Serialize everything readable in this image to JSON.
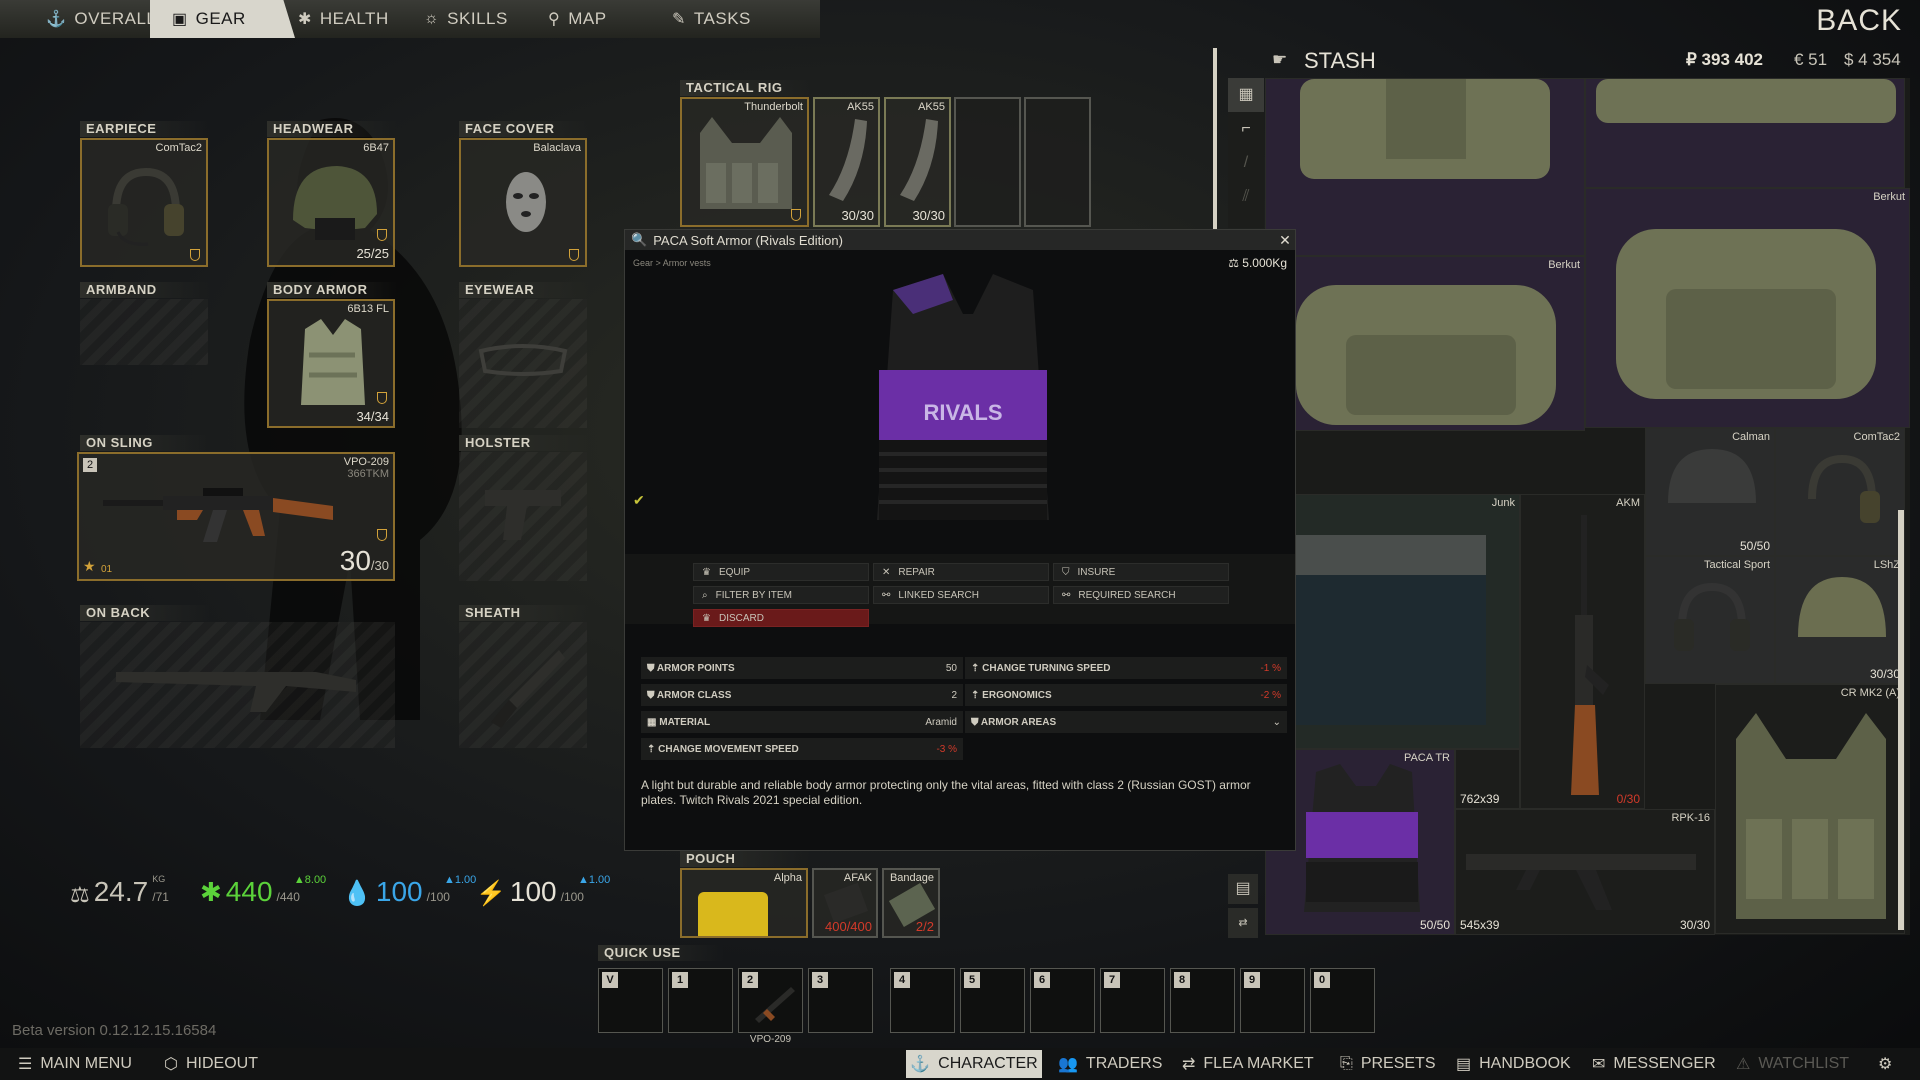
{
  "nav": {
    "tabs": [
      {
        "label": "OVERALL",
        "icon": "anchor-icon"
      },
      {
        "label": "GEAR",
        "icon": "vest-icon"
      },
      {
        "label": "HEALTH",
        "icon": "health-icon"
      },
      {
        "label": "SKILLS",
        "icon": "skills-icon"
      },
      {
        "label": "MAP",
        "icon": "map-pin-icon"
      },
      {
        "label": "TASKS",
        "icon": "tasks-icon"
      }
    ],
    "back_label": "BACK"
  },
  "slots": {
    "earpiece": {
      "label": "EARPIECE",
      "item": "ComTac2"
    },
    "headwear": {
      "label": "HEADWEAR",
      "item": "6B47",
      "durability": "25/25"
    },
    "face_cover": {
      "label": "FACE COVER",
      "item": "Balaclava"
    },
    "armband": {
      "label": "ARMBAND"
    },
    "body_armor": {
      "label": "BODY ARMOR",
      "item": "6B13 FL",
      "durability": "34/34"
    },
    "eyewear": {
      "label": "EYEWEAR"
    },
    "on_sling": {
      "label": "ON SLING",
      "item": "VPO-209",
      "sub": "366TKM",
      "ammo": "30",
      "ammo_max": "/30",
      "slot_key": "2",
      "rank": "01"
    },
    "holster": {
      "label": "HOLSTER"
    },
    "on_back": {
      "label": "ON BACK"
    },
    "sheath": {
      "label": "SHEATH"
    },
    "tactical_rig": {
      "label": "TACTICAL RIG",
      "item": "Thunderbolt",
      "mags": [
        {
          "name": "AK55",
          "count": "30/30"
        },
        {
          "name": "AK55",
          "count": "30/30"
        }
      ]
    },
    "pouch": {
      "label": "POUCH",
      "item": "Alpha",
      "items": [
        {
          "name": "AFAK",
          "count": "400/400"
        },
        {
          "name": "Bandage",
          "count": "2/2"
        }
      ]
    }
  },
  "stats": {
    "weight": {
      "value": "24.7",
      "unit": "KG",
      "max": "/71"
    },
    "health": {
      "value": "440",
      "max": "/440",
      "rate": "8.00"
    },
    "hydration": {
      "value": "100",
      "max": "/100",
      "rate": "1.00"
    },
    "energy": {
      "value": "100",
      "max": "/100",
      "rate": "1.00"
    }
  },
  "beta_version": "Beta version 0.12.12.15.16584",
  "modal": {
    "title": "PACA Soft Armor (Rivals Edition)",
    "breadcrumb": "Gear > Armor vests",
    "weight": "5.000Kg",
    "actions": [
      {
        "label": "EQUIP",
        "icon": "equip-icon"
      },
      {
        "label": "REPAIR",
        "icon": "repair-icon"
      },
      {
        "label": "INSURE",
        "icon": "insure-icon"
      },
      {
        "label": "FILTER BY ITEM",
        "icon": "filter-icon"
      },
      {
        "label": "LINKED SEARCH",
        "icon": "linked-icon"
      },
      {
        "label": "REQUIRED SEARCH",
        "icon": "required-icon"
      },
      {
        "label": "DISCARD",
        "icon": "discard-icon"
      }
    ],
    "props_left": [
      {
        "label": "ARMOR POINTS",
        "value": "50"
      },
      {
        "label": "ARMOR CLASS",
        "value": "2"
      },
      {
        "label": "MATERIAL",
        "value": "Aramid"
      },
      {
        "label": "CHANGE MOVEMENT SPEED",
        "value": "-3 %"
      }
    ],
    "props_right": [
      {
        "label": "CHANGE TURNING SPEED",
        "value": "-1 %"
      },
      {
        "label": "ERGONOMICS",
        "value": "-2 %"
      },
      {
        "label": "ARMOR AREAS",
        "value": ""
      }
    ],
    "description": "A light but durable and reliable body armor protecting only the vital areas, fitted with class 2 (Russian GOST) armor plates. Twitch Rivals 2021 special edition.",
    "vest_logo": "RIVALS"
  },
  "stash": {
    "title": "STASH",
    "rub": "₽ 393 402",
    "eur": "€ 51",
    "usd": "$ 4 354",
    "items": [
      {
        "name": "Berkut"
      },
      {
        "name": "Berkut"
      },
      {
        "name": "Calman",
        "count": "50/50"
      },
      {
        "name": "ComTac2"
      },
      {
        "name": "Junk"
      },
      {
        "name": "AKM",
        "count": "0/30"
      },
      {
        "name": "Tactical Sport"
      },
      {
        "name": "LShZ",
        "count": "30/30"
      },
      {
        "name": "CR MK2 (A)"
      },
      {
        "name": "762x39"
      },
      {
        "name": "PACA TR",
        "count": "50/50"
      },
      {
        "name": "545x39"
      },
      {
        "name": "RPK-16",
        "count": "30/30"
      }
    ]
  },
  "quick_use": {
    "label": "QUICK USE",
    "keys": [
      "V",
      "1",
      "2",
      "3",
      "4",
      "5",
      "6",
      "7",
      "8",
      "9",
      "0"
    ],
    "slot2_item": "VPO-209"
  },
  "bottom_bar": [
    {
      "label": "MAIN MENU",
      "icon": "menu-icon"
    },
    {
      "label": "HIDEOUT",
      "icon": "hideout-icon"
    },
    {
      "label": "CHARACTER",
      "icon": "character-icon"
    },
    {
      "label": "TRADERS",
      "icon": "traders-icon"
    },
    {
      "label": "FLEA MARKET",
      "icon": "flea-icon"
    },
    {
      "label": "PRESETS",
      "icon": "presets-icon"
    },
    {
      "label": "HANDBOOK",
      "icon": "handbook-icon"
    },
    {
      "label": "MESSENGER",
      "icon": "messenger-icon"
    },
    {
      "label": "WATCHLIST",
      "icon": "watchlist-icon"
    }
  ],
  "colors": {
    "accent": "#8b6d2b",
    "active_tab": "#d8d6cc",
    "discard": "#6a1a1a",
    "negative": "#d23a2a",
    "health": "#5bd23a",
    "water": "#3aa6e8"
  }
}
